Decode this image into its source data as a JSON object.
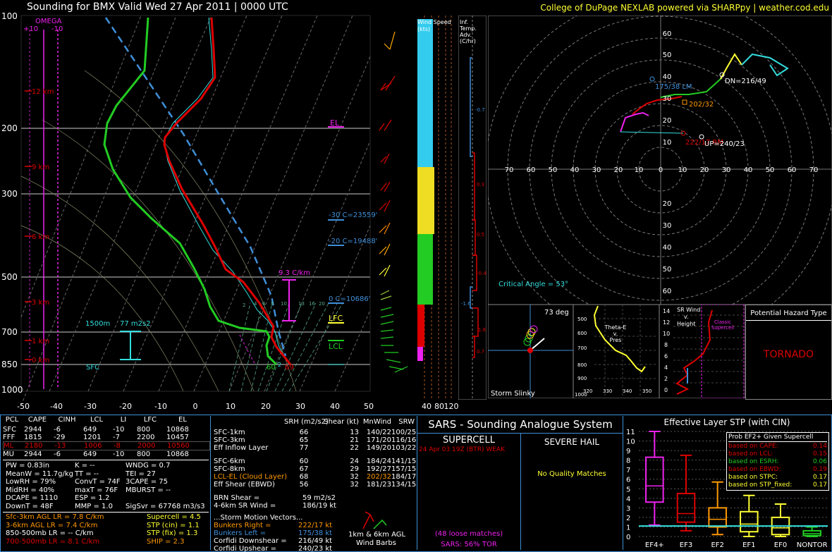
{
  "header": {
    "title": "Sounding for BMX Valid  Wed 27 Apr 2011 | 0000 UTC",
    "credit": "College of DuPage NEXLAB powered via SHARPpy | weather.cod.edu"
  },
  "colors": {
    "accent_yellow": "#ffff33",
    "border_blue": "#3f8fd8",
    "temp_red": "#dd0000",
    "dew_green": "#22cc22",
    "cyan": "#33dddd",
    "magenta": "#ee22ee"
  },
  "skewt": {
    "pressure_levels": [
      "100",
      "200",
      "300",
      "500",
      "700",
      "850",
      "1000"
    ],
    "x_ticks": [
      "-50",
      "-40",
      "-30",
      "-20",
      "-10",
      "0",
      "10",
      "20",
      "30",
      "40",
      "50"
    ],
    "height_labels": [
      "12 km",
      "9 km",
      "6 km",
      "3 km",
      "1 km",
      "0 km"
    ],
    "omega_title": "OMEGA",
    "omega_plus": "+10",
    "omega_minus": "-10",
    "el_label": "EL",
    "lfc_label": "LFC",
    "lcl_label": "LCL",
    "lapse_label": "9.3 C/km",
    "level_m30": "-30 C=23559'",
    "level_m20": "-20 C=19488'",
    "level_0": "0 C=10686'",
    "helicity_height": "1500m",
    "helicity_value": "77 m2s2",
    "sfc_label": "SFC",
    "sfc_dew": "60",
    "sfc_wet": "2",
    "sfc_temp": "69",
    "mixing_ratios": [
      "2",
      "4",
      "6",
      "8",
      "10",
      "13",
      "16",
      "20"
    ]
  },
  "wind_speed_panel": {
    "title": "Wind Speed (kts)",
    "ticks": [
      "40",
      "80",
      "120"
    ]
  },
  "temp_adv_panel": {
    "title": "Inf. Temp. Adv. (C/hr)",
    "values": [
      "-0.7",
      "0.3",
      "0.5",
      "-0.4",
      "-1.6",
      "1.8",
      "0.7"
    ]
  },
  "hodograph": {
    "rings": [
      "10",
      "20",
      "30",
      "40",
      "50",
      "60"
    ],
    "x_labels": [
      "70",
      "60",
      "50",
      "40",
      "30",
      "20",
      "10",
      "0",
      "10",
      "20",
      "30",
      "40",
      "50",
      "60",
      "70"
    ],
    "lm_label": "175/38 LM",
    "dn_label": "DN=216/49",
    "mean_label": "202/32",
    "rm_label": "222/17 RM",
    "up_label": "UP=240/23",
    "critical_angle": "Critical Angle = 53°"
  },
  "storm_slinky": {
    "title": "Storm Slinky",
    "angle": "73 deg"
  },
  "theta_e": {
    "title_line1": "Theta-E",
    "title_line2": "v.",
    "title_line3": "Pres",
    "y_ticks": [
      "500",
      "600",
      "700",
      "800",
      "900",
      "1000"
    ],
    "x_ticks": [
      "320",
      "330",
      "340",
      "350"
    ]
  },
  "sr_wind": {
    "title_line1": "SR Wind",
    "title_line2": "v.",
    "title_line3": "Height",
    "y_ticks": [
      "14",
      "12",
      "10",
      "8",
      "6",
      "4",
      "2",
      "0"
    ],
    "note_line1": "Classic",
    "note_line2": "Supercell"
  },
  "hazard": {
    "title": "Potential Hazard Type",
    "type": "TORNADO"
  },
  "parcels": {
    "headers": [
      "PCL",
      "CAPE",
      "CINH",
      "LCL",
      "LI",
      "LFC",
      "EL"
    ],
    "rows": [
      [
        "SFC",
        "2944",
        "-6",
        "649",
        "-10",
        "800",
        "10868"
      ],
      [
        "FFF",
        "1815",
        "-29",
        "1201",
        "-7",
        "2200",
        "10457"
      ],
      [
        "ML",
        "2180",
        "-13",
        "1006",
        "-8",
        "2000",
        "10560"
      ],
      [
        "MU",
        "2944",
        "-6",
        "649",
        "-10",
        "800",
        "10868"
      ]
    ]
  },
  "thermo": {
    "left": [
      "PW = 0.83in",
      "MeanW = 11.7g/kg",
      "LowRH = 79%",
      "MidRH = 40%",
      "DCAPE = 1110",
      "DownT = 48F"
    ],
    "mid": [
      "K = --",
      "TT = --",
      "ConvT = 74F",
      "maxT = 76F",
      "ESP = 1.2",
      "MMP = 1.0"
    ],
    "right": [
      "WNDG = 0.7",
      "TEI = 27",
      "3CAPE = 75",
      "MBURST = --",
      "",
      "SigSvr = 67768 m3/s3"
    ]
  },
  "lapse": {
    "left": [
      "Sfc-3km AGL LR = 7.8 C/km",
      "3-6km AGL LR = 7.4 C/km",
      "850-500mb LR = -- C/km",
      "700-500mb LR = 8.1 C/km"
    ],
    "right": [
      "Supercell = 4.5",
      "STP (cin) = 1.1",
      "STP (fix) = 1.3",
      "SHIP = 2.3"
    ]
  },
  "kinematics": {
    "headers": [
      "SRH (m2/s2)",
      "Shear (kt)",
      "MnWind",
      "SRW"
    ],
    "rows": [
      [
        "SFC-1km",
        "66",
        "13",
        "140/22",
        "100/25"
      ],
      [
        "SFC-3km",
        "65",
        "21",
        "171/20",
        "116/16"
      ],
      [
        "Eff Inflow Layer",
        "77",
        "22",
        "149/20",
        "103/22"
      ],
      [
        "SFC-6km",
        "60",
        "24",
        "184/24",
        "141/15"
      ],
      [
        "SFC-8km",
        "67",
        "29",
        "192/27",
        "157/15"
      ],
      [
        "LCL-EL (Cloud Layer)",
        "68",
        "32",
        "202/32",
        "184/17"
      ],
      [
        "Eff Shear (EBWD)",
        "56",
        "32",
        "181/23",
        "134/15"
      ]
    ],
    "brn_shear_label": "BRN Shear =",
    "brn_shear_value": "59 m2/s2",
    "sr_wind_label": "4-6km SR Wind =",
    "sr_wind_value": "186/19 kt",
    "storm_motion_title": "...Storm Motion Vectors...",
    "motion_rows": [
      [
        "Bunkers Right =",
        "222/17 kt"
      ],
      [
        "Bunkers Left =",
        "175/38 kt"
      ],
      [
        "Corfidi Downshear =",
        "216/49 kt"
      ],
      [
        "Corfidi Upshear =",
        "240/23 kt"
      ]
    ],
    "barb_caption_line1": "1km & 6km AGL",
    "barb_caption_line2": "Wind Barbs"
  },
  "sars": {
    "title": "SARS - Sounding Analogue System",
    "supercell_title": "SUPERCELL",
    "hail_title": "SEVERE HAIL",
    "match": "24 Apr 03 19Z (BTR)   WEAK",
    "hail_msg": "No Quality Matches",
    "loose": "(48 loose matches)",
    "tor": "SARS: 56% TOR"
  },
  "stp": {
    "title": "Effective Layer STP (with CIN)",
    "prob_title": "Prob EF2+ Given Supercell",
    "prob_rows": [
      [
        "based on CAPE:",
        "0.14"
      ],
      [
        "based on LCL:",
        "0.15"
      ],
      [
        "based on ESRH:",
        "0.06"
      ],
      [
        "based on EBWD:",
        "0.19"
      ],
      [
        "based on STPC:",
        "0.17"
      ],
      [
        "based on STP_fixed:",
        "0.17"
      ]
    ],
    "categories": [
      "EF4+",
      "EF3",
      "EF2",
      "EF1",
      "EF0",
      "NONTOR"
    ],
    "y_ticks": [
      "0",
      "1",
      "2",
      "3",
      "4",
      "5",
      "6",
      "7",
      "8",
      "9",
      "10",
      "11"
    ]
  },
  "chart_data": {
    "type": "box",
    "title": "Effective Layer STP (with CIN)",
    "categories": [
      "EF4+",
      "EF3",
      "EF2",
      "EF1",
      "EF0",
      "NONTOR"
    ],
    "series": [
      {
        "name": "EF4+",
        "whisker_low": 1.2,
        "q1": 3.6,
        "median": 5.3,
        "q3": 8.3,
        "whisker_high": 11.0
      },
      {
        "name": "EF3",
        "whisker_low": 0.6,
        "q1": 1.5,
        "median": 2.4,
        "q3": 4.5,
        "whisker_high": 8.5
      },
      {
        "name": "EF2",
        "whisker_low": 0.2,
        "q1": 1.0,
        "median": 1.8,
        "q3": 3.0,
        "whisker_high": 5.7
      },
      {
        "name": "EF1",
        "whisker_low": 0.0,
        "q1": 0.5,
        "median": 1.3,
        "q3": 2.6,
        "whisker_high": 4.3
      },
      {
        "name": "EF0",
        "whisker_low": 0.0,
        "q1": 0.2,
        "median": 0.9,
        "q3": 2.0,
        "whisker_high": 3.4
      },
      {
        "name": "NONTOR",
        "whisker_low": 0.0,
        "q1": 0.1,
        "median": 0.3,
        "q3": 0.6,
        "whisker_high": 1.0
      }
    ],
    "current_value": 1.1,
    "ylim": [
      0,
      11
    ]
  }
}
